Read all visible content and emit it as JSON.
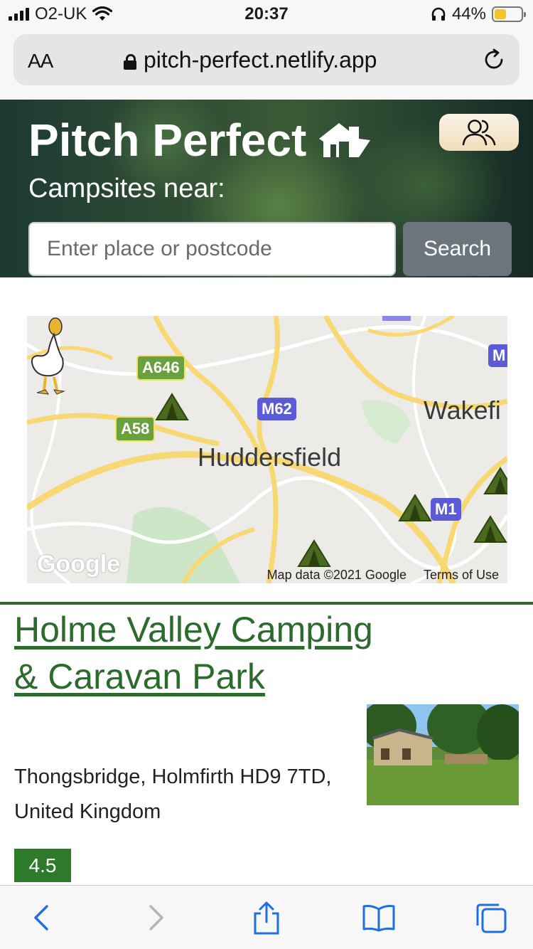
{
  "status_bar": {
    "carrier": "O2-UK",
    "time": "20:37",
    "battery_percent": "44%",
    "battery_level": 0.44,
    "icons": [
      "signal-icon",
      "wifi-icon",
      "headphones-icon",
      "battery-icon"
    ]
  },
  "browser": {
    "text_size_label": "AA",
    "url": "pitch-perfect.netlify.app",
    "icons": [
      "lock-icon",
      "reload-icon"
    ]
  },
  "header": {
    "app_title": "Pitch Perfect",
    "subtitle": "Campsites near:",
    "search_placeholder": "Enter place or postcode",
    "search_button": "Search",
    "icons": [
      "logo-house-icon",
      "users-icon"
    ]
  },
  "map": {
    "town_main": "Huddersfield",
    "town_edge": "Wakefi",
    "road_labels": {
      "a646": "A646",
      "a58": "A58",
      "m62": "M62",
      "m1": "M1",
      "m_edge": "M"
    },
    "google_logo": "Google",
    "map_data": "Map data ©2021 Google",
    "terms": "Terms of Use",
    "icons": [
      "tent-icon",
      "duck-pin-icon"
    ]
  },
  "listing": {
    "title": "Holme Valley Camping & Caravan Park",
    "address": "Thongsbridge, Holmfirth HD9 7TD, United Kingdom",
    "rating": "4.5"
  },
  "toolbar": {
    "icons": [
      "back-icon",
      "forward-icon",
      "share-icon",
      "bookmarks-icon",
      "tabs-icon"
    ]
  },
  "colors": {
    "brand_green": "#2d6a2d",
    "rating_green": "#2d7a2a",
    "search_button": "#6c757d",
    "ios_blue": "#1a73e8"
  }
}
